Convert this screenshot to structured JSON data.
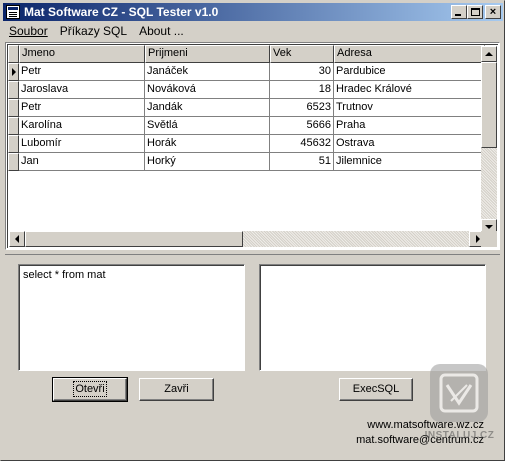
{
  "window": {
    "title": "Mat Software CZ - SQL Tester v1.0",
    "close_glyph": "×"
  },
  "menu": {
    "items": [
      {
        "label": "Soubor",
        "mnemonic_index": 0
      },
      {
        "label": "Příkazy SQL",
        "mnemonic_index": 0
      },
      {
        "label": "About ...",
        "mnemonic_index": 0
      }
    ]
  },
  "grid": {
    "columns": [
      "Jmeno",
      "Prijmeni",
      "Vek",
      "Adresa"
    ],
    "rows": [
      {
        "jmeno": "Petr",
        "prijmeni": "Janáček",
        "vek": "30",
        "adresa": "Pardubice"
      },
      {
        "jmeno": "Jaroslava",
        "prijmeni": "Nováková",
        "vek": "18",
        "adresa": "Hradec Králové"
      },
      {
        "jmeno": "Petr",
        "prijmeni": "Jandák",
        "vek": "6523",
        "adresa": "Trutnov"
      },
      {
        "jmeno": "Karolína",
        "prijmeni": "Světlá",
        "vek": "5666",
        "adresa": "Praha"
      },
      {
        "jmeno": "Lubomír",
        "prijmeni": "Horák",
        "vek": "45632",
        "adresa": "Ostrava"
      },
      {
        "jmeno": "Jan",
        "prijmeni": "Horký",
        "vek": "51",
        "adresa": "Jilemnice"
      }
    ],
    "current_row": 0
  },
  "sql_input": {
    "value": "select * from mat"
  },
  "result_box": {
    "value": ""
  },
  "buttons": {
    "open": "Otevři",
    "close": "Zavři",
    "exec": "ExecSQL"
  },
  "footer": {
    "web": "www.matsoftware.wz.cz",
    "email": "mat.software@centrum.cz"
  },
  "watermark": {
    "text": "INSTALUJ.CZ"
  },
  "colors": {
    "title_gradient_start": "#0a246a",
    "title_gradient_end": "#a6caf0",
    "face": "#d4d0c8"
  }
}
